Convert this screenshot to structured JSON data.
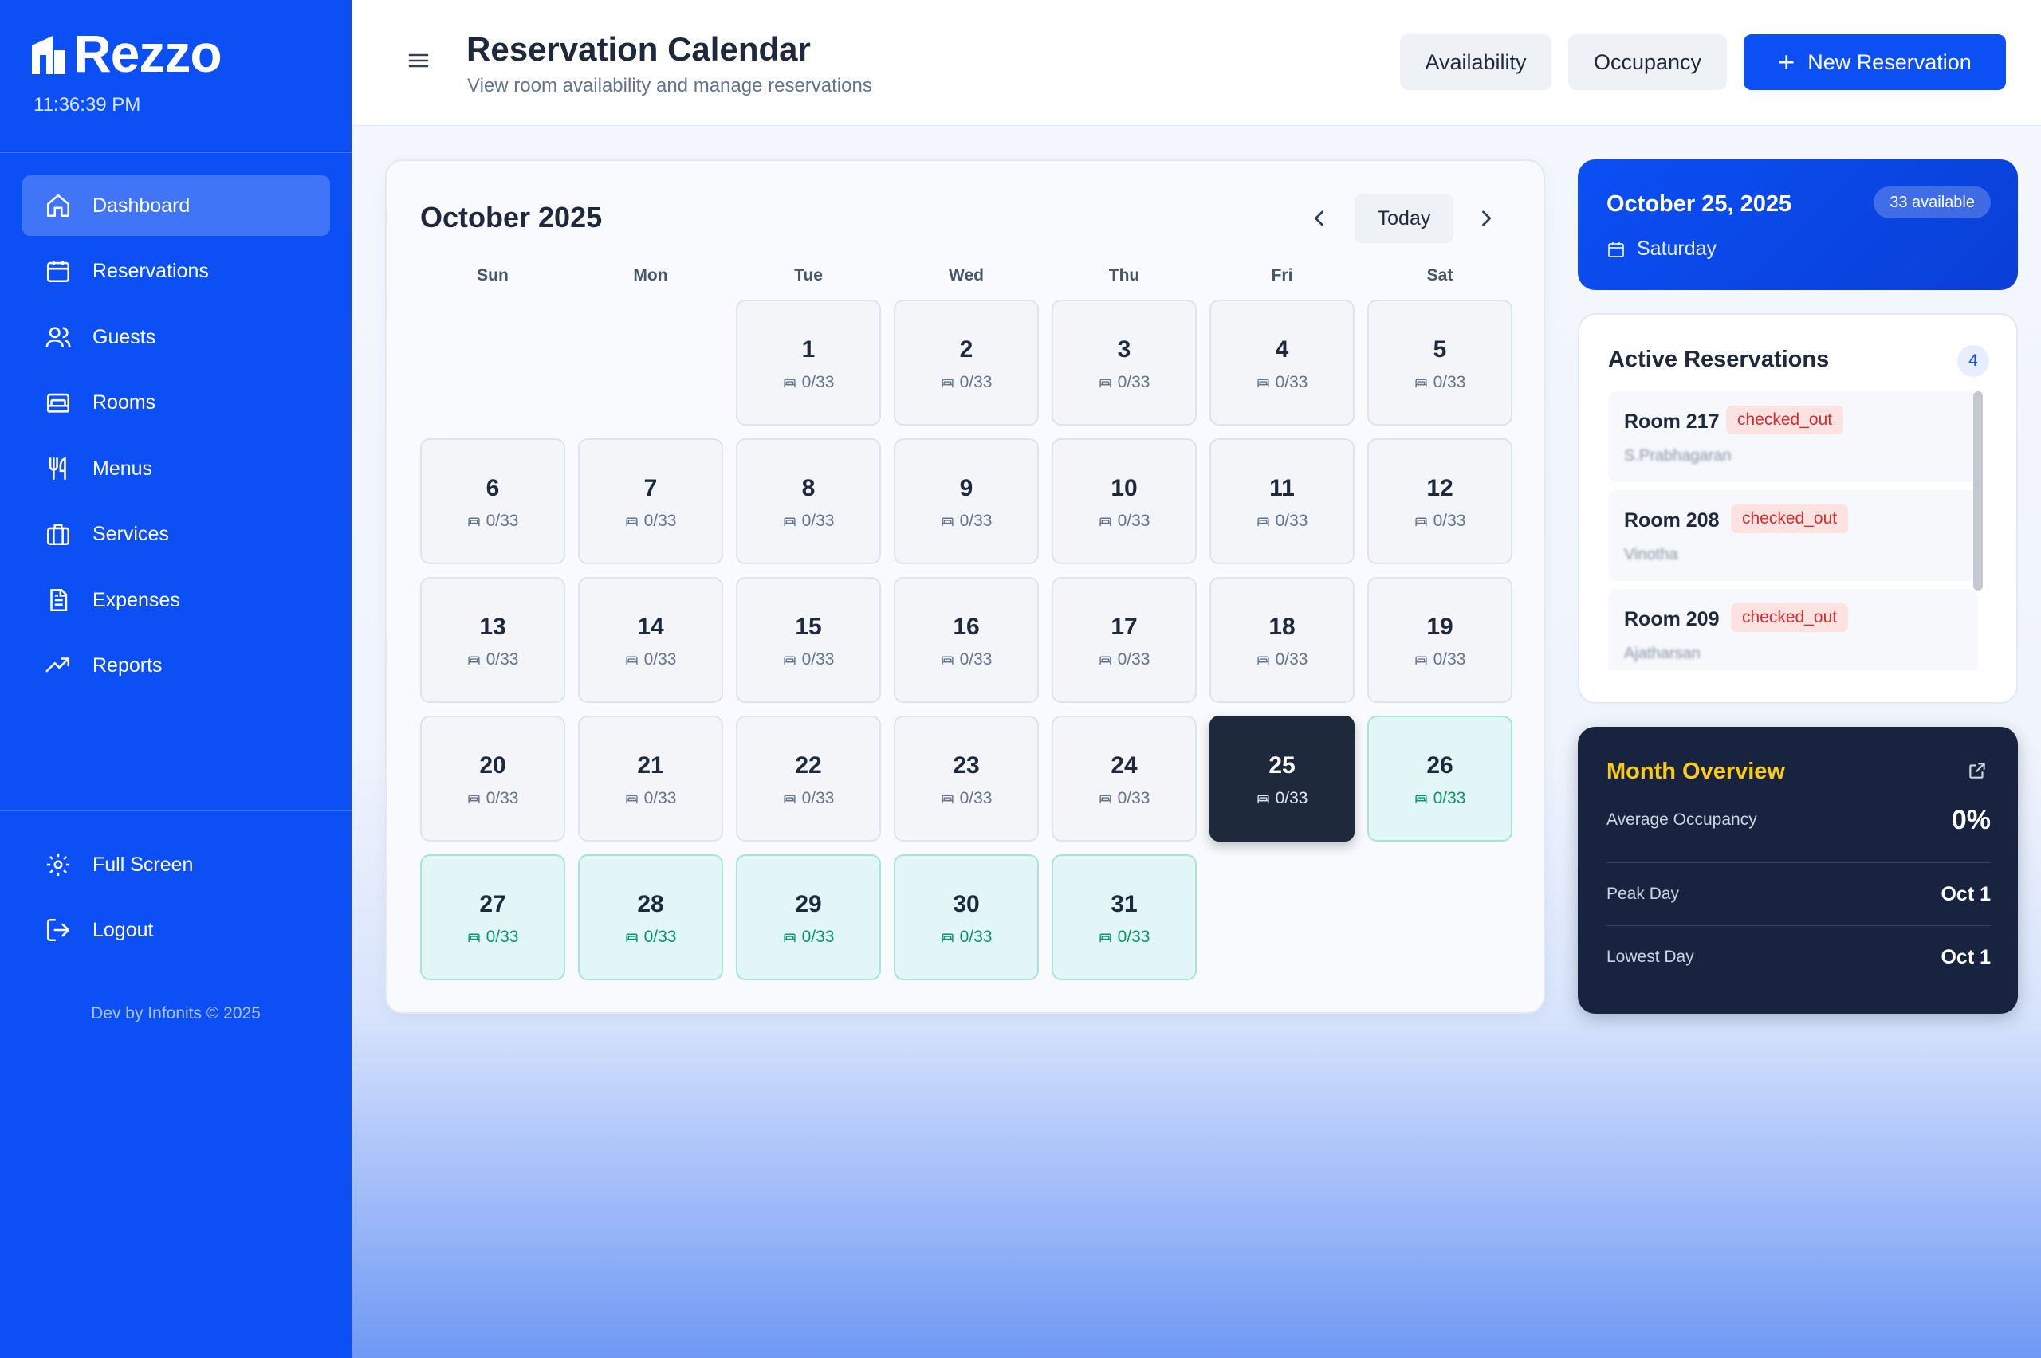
{
  "app": {
    "brand": "Rezzo",
    "clock": "11:36:39 PM",
    "footer": "Dev by Infonits © 2025"
  },
  "sidebar": {
    "items": [
      {
        "label": "Dashboard",
        "icon": "home-icon",
        "active": true
      },
      {
        "label": "Reservations",
        "icon": "calendar-icon"
      },
      {
        "label": "Guests",
        "icon": "users-icon"
      },
      {
        "label": "Rooms",
        "icon": "bed-icon"
      },
      {
        "label": "Menus",
        "icon": "utensils-icon"
      },
      {
        "label": "Services",
        "icon": "briefcase-icon"
      },
      {
        "label": "Expenses",
        "icon": "receipt-icon"
      },
      {
        "label": "Reports",
        "icon": "trending-up-icon"
      }
    ],
    "bottom": [
      {
        "label": "Full Screen",
        "icon": "gear-icon"
      },
      {
        "label": "Logout",
        "icon": "logout-icon"
      }
    ]
  },
  "header": {
    "title": "Reservation Calendar",
    "subtitle": "View room availability and manage reservations",
    "buttons": {
      "availability": "Availability",
      "occupancy": "Occupancy",
      "new_reservation": "New Reservation"
    }
  },
  "calendar": {
    "month_label": "October 2025",
    "today_button": "Today",
    "weekdays": [
      "Sun",
      "Mon",
      "Tue",
      "Wed",
      "Thu",
      "Fri",
      "Sat"
    ],
    "first_weekday_index": 3,
    "today_day": 25,
    "days": [
      {
        "day": "1",
        "occ": "0/33",
        "state": "past"
      },
      {
        "day": "2",
        "occ": "0/33",
        "state": "past"
      },
      {
        "day": "3",
        "occ": "0/33",
        "state": "past"
      },
      {
        "day": "4",
        "occ": "0/33",
        "state": "past"
      },
      {
        "day": "5",
        "occ": "0/33",
        "state": "past"
      },
      {
        "day": "6",
        "occ": "0/33",
        "state": "past"
      },
      {
        "day": "7",
        "occ": "0/33",
        "state": "past"
      },
      {
        "day": "8",
        "occ": "0/33",
        "state": "past"
      },
      {
        "day": "9",
        "occ": "0/33",
        "state": "past"
      },
      {
        "day": "10",
        "occ": "0/33",
        "state": "past"
      },
      {
        "day": "11",
        "occ": "0/33",
        "state": "past"
      },
      {
        "day": "12",
        "occ": "0/33",
        "state": "past"
      },
      {
        "day": "13",
        "occ": "0/33",
        "state": "past"
      },
      {
        "day": "14",
        "occ": "0/33",
        "state": "past"
      },
      {
        "day": "15",
        "occ": "0/33",
        "state": "past"
      },
      {
        "day": "16",
        "occ": "0/33",
        "state": "past"
      },
      {
        "day": "17",
        "occ": "0/33",
        "state": "past"
      },
      {
        "day": "18",
        "occ": "0/33",
        "state": "past"
      },
      {
        "day": "19",
        "occ": "0/33",
        "state": "past"
      },
      {
        "day": "20",
        "occ": "0/33",
        "state": "past"
      },
      {
        "day": "21",
        "occ": "0/33",
        "state": "past"
      },
      {
        "day": "22",
        "occ": "0/33",
        "state": "past"
      },
      {
        "day": "23",
        "occ": "0/33",
        "state": "past"
      },
      {
        "day": "24",
        "occ": "0/33",
        "state": "past"
      },
      {
        "day": "25",
        "occ": "0/33",
        "state": "today"
      },
      {
        "day": "26",
        "occ": "0/33",
        "state": "future"
      },
      {
        "day": "27",
        "occ": "0/33",
        "state": "future"
      },
      {
        "day": "28",
        "occ": "0/33",
        "state": "future"
      },
      {
        "day": "29",
        "occ": "0/33",
        "state": "future"
      },
      {
        "day": "30",
        "occ": "0/33",
        "state": "future"
      },
      {
        "day": "31",
        "occ": "0/33",
        "state": "future"
      }
    ]
  },
  "date_card": {
    "date": "October 25, 2025",
    "badge": "33 available",
    "weekday": "Saturday"
  },
  "reservations": {
    "title": "Active Reservations",
    "count": "4",
    "items": [
      {
        "room": "Room 217",
        "status": "checked_out",
        "guest": "S.Prabhagaran"
      },
      {
        "room": "Room 208",
        "status": "checked_out",
        "guest": "Vinotha"
      },
      {
        "room": "Room 209",
        "status": "checked_out",
        "guest": "Ajatharsan"
      }
    ]
  },
  "overview": {
    "title": "Month Overview",
    "rows": [
      {
        "label": "Average Occupancy",
        "value": "0%"
      },
      {
        "label": "Peak Day",
        "value": "Oct 1"
      },
      {
        "label": "Lowest Day",
        "value": "Oct 1"
      }
    ]
  },
  "colors": {
    "brand_blue": "#0b4ff5",
    "today_cell": "#1e293b",
    "future_cell": "#e3f6f7",
    "status_red": "#d32f2f",
    "overview_bg": "#17233f",
    "overview_title": "#facc15"
  }
}
